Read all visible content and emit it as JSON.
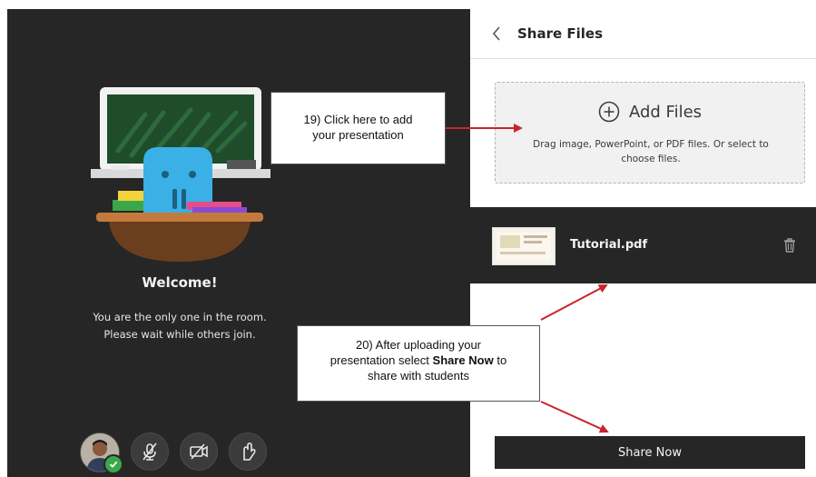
{
  "stage": {
    "welcome_title": "Welcome!",
    "welcome_line1": "You are the only one in the room.",
    "welcome_line2": "Please wait while others join."
  },
  "controls": {
    "avatar": "user-avatar",
    "mic": "microphone-muted-icon",
    "camera": "camera-off-icon",
    "hand": "raise-hand-icon"
  },
  "panel": {
    "title": "Share Files",
    "add_files_label": "Add Files",
    "drop_hint_line1": "Drag image, PowerPoint, or PDF files. Or select to",
    "drop_hint_line2": "choose files.",
    "file_name": "Tutorial.pdf",
    "share_button": "Share Now"
  },
  "annotations": {
    "step19_line1": "19) Click here to add",
    "step19_line2": "your presentation",
    "step20_line1": "20) After uploading your",
    "step20_line2_a": "presentation select ",
    "step20_line2_b": "Share Now",
    "step20_line2_c": " to",
    "step20_line3": "share with students"
  },
  "colors": {
    "stage_bg": "#262626",
    "panel_bg": "#ffffff",
    "arrow": "#c8242a",
    "status_green": "#3aa84a"
  }
}
